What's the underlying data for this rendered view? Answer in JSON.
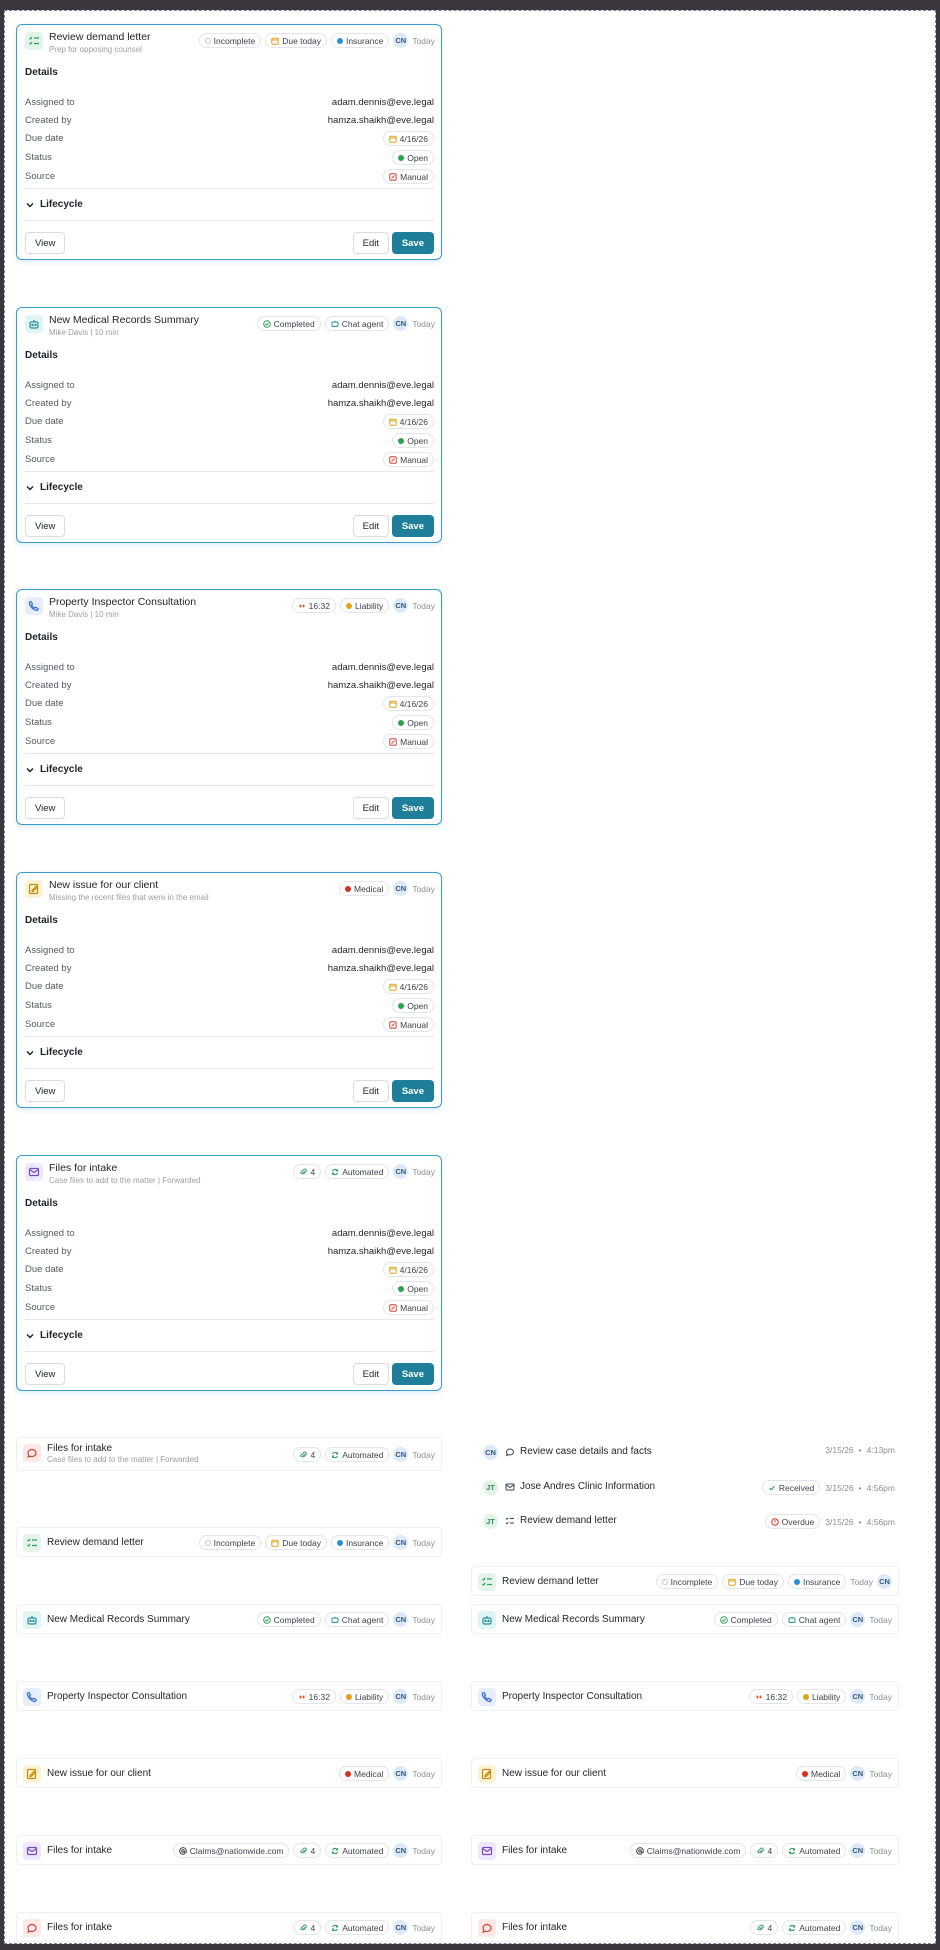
{
  "colors": {
    "accent": "#1f7e99",
    "border_active": "#3a9cc9",
    "status_open": "#2fa24f",
    "insurance": "#2b8fd1",
    "liability": "#e2a21a",
    "medical": "#d93025",
    "overdue": "#d93025",
    "received": "#2f9e5b"
  },
  "common": {
    "details_label": "Details",
    "assigned_label": "Assigned to",
    "created_label": "Created by",
    "due_label": "Due date",
    "status_label": "Status",
    "source_label": "Source",
    "assigned_value": "adam.dennis@eve.legal",
    "created_value": "hamza.shaikh@eve.legal",
    "due_value": "4/16/26",
    "status_value": "Open",
    "source_value": "Manual",
    "lifecycle_label": "Lifecycle",
    "view_label": "View",
    "edit_label": "Edit",
    "save_label": "Save",
    "avatar": "CN",
    "today": "Today"
  },
  "cards": [
    {
      "title": "Review demand letter",
      "subtitle": "Prep for opposing counsel",
      "chips": [
        "Incomplete",
        "Due today",
        "Insurance"
      ]
    },
    {
      "title": "New Medical Records Summary",
      "subtitle": "Mike Davis | 10 min",
      "chips": [
        "Completed",
        "Chat agent"
      ]
    },
    {
      "title": "Property Inspector Consultation",
      "subtitle": "Mike Davis | 10 min",
      "chips": [
        "16:32",
        "Liability"
      ]
    },
    {
      "title": "New issue for our client",
      "subtitle": "Missing the recent files that were in the email",
      "chips": [
        "Medical"
      ]
    },
    {
      "title": "Files for intake",
      "subtitle": "Case files to add to the matter | Forwarded",
      "chips": [
        "4",
        "Automated"
      ]
    }
  ],
  "compact_left": [
    {
      "title": "Files for intake",
      "subtitle": "Case files to add to the matter | Forwarded",
      "chips": [
        "4",
        "Automated"
      ]
    },
    {
      "title": "Review demand letter",
      "chips": [
        "Incomplete",
        "Due today",
        "Insurance"
      ]
    },
    {
      "title": "New Medical Records Summary",
      "chips": [
        "Completed",
        "Chat agent"
      ]
    },
    {
      "title": "Property Inspector Consultation",
      "chips": [
        "16:32",
        "Liability"
      ]
    },
    {
      "title": "New issue for our client",
      "chips": [
        "Medical"
      ]
    },
    {
      "title": "Files for intake",
      "chips": [
        "Claims@nationwide.com",
        "4",
        "Automated"
      ]
    },
    {
      "title": "Files for intake",
      "chips": [
        "4",
        "Automated"
      ]
    }
  ],
  "activity": [
    {
      "avatar": "CN",
      "title": "Review case details and facts",
      "date": "3/15/26",
      "time": "4:13pm"
    },
    {
      "avatar": "JT",
      "title": "Jose Andres Clinic Information",
      "badge": "Received",
      "date": "3/15/26",
      "time": "4:56pm"
    },
    {
      "avatar": "JT",
      "title": "Review demand letter",
      "badge": "Overdue",
      "date": "3/15/26",
      "time": "4:56pm"
    }
  ],
  "compact_right": [
    {
      "title": "Review demand letter",
      "chips": [
        "Incomplete",
        "Due today",
        "Insurance"
      ]
    },
    {
      "title": "New Medical Records Summary",
      "chips": [
        "Completed",
        "Chat agent"
      ]
    },
    {
      "title": "Property Inspector Consultation",
      "chips": [
        "16:32",
        "Liability"
      ]
    },
    {
      "title": "New issue for our client",
      "chips": [
        "Medical"
      ]
    },
    {
      "title": "Files for intake",
      "chips": [
        "Claims@nationwide.com",
        "4",
        "Automated"
      ]
    },
    {
      "title": "Files for intake",
      "chips": [
        "4",
        "Automated"
      ]
    }
  ],
  "separator": "•"
}
